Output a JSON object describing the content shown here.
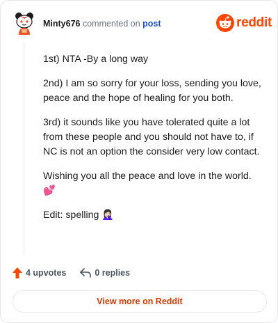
{
  "header": {
    "username": "Minty676",
    "commented_text": "commented on",
    "post_link": "post",
    "brand": "reddit",
    "brand_color": "#ff4500"
  },
  "comment": {
    "paragraphs": [
      "1st) NTA -By a long way",
      "2nd) I am so sorry for your loss, sending you love, peace and the hope of healing for you both.",
      "3rd) it sounds like you have tolerated quite a lot from these people and you should not have to, if NC is not an option the consider very low contact.",
      "Wishing you all the peace and love in the world. 💕",
      "Edit: spelling 🤦🏻‍♀️"
    ]
  },
  "actions": {
    "upvote_icon": "upvote-arrow-icon",
    "upvotes": "4 upvotes",
    "reply_icon": "reply-arrow-icon",
    "replies": "0 replies"
  },
  "footer": {
    "view_more": "View more on Reddit"
  },
  "colors": {
    "accent": "#d93a00",
    "upvote": "#ff4500",
    "link": "#1d4ed8"
  }
}
